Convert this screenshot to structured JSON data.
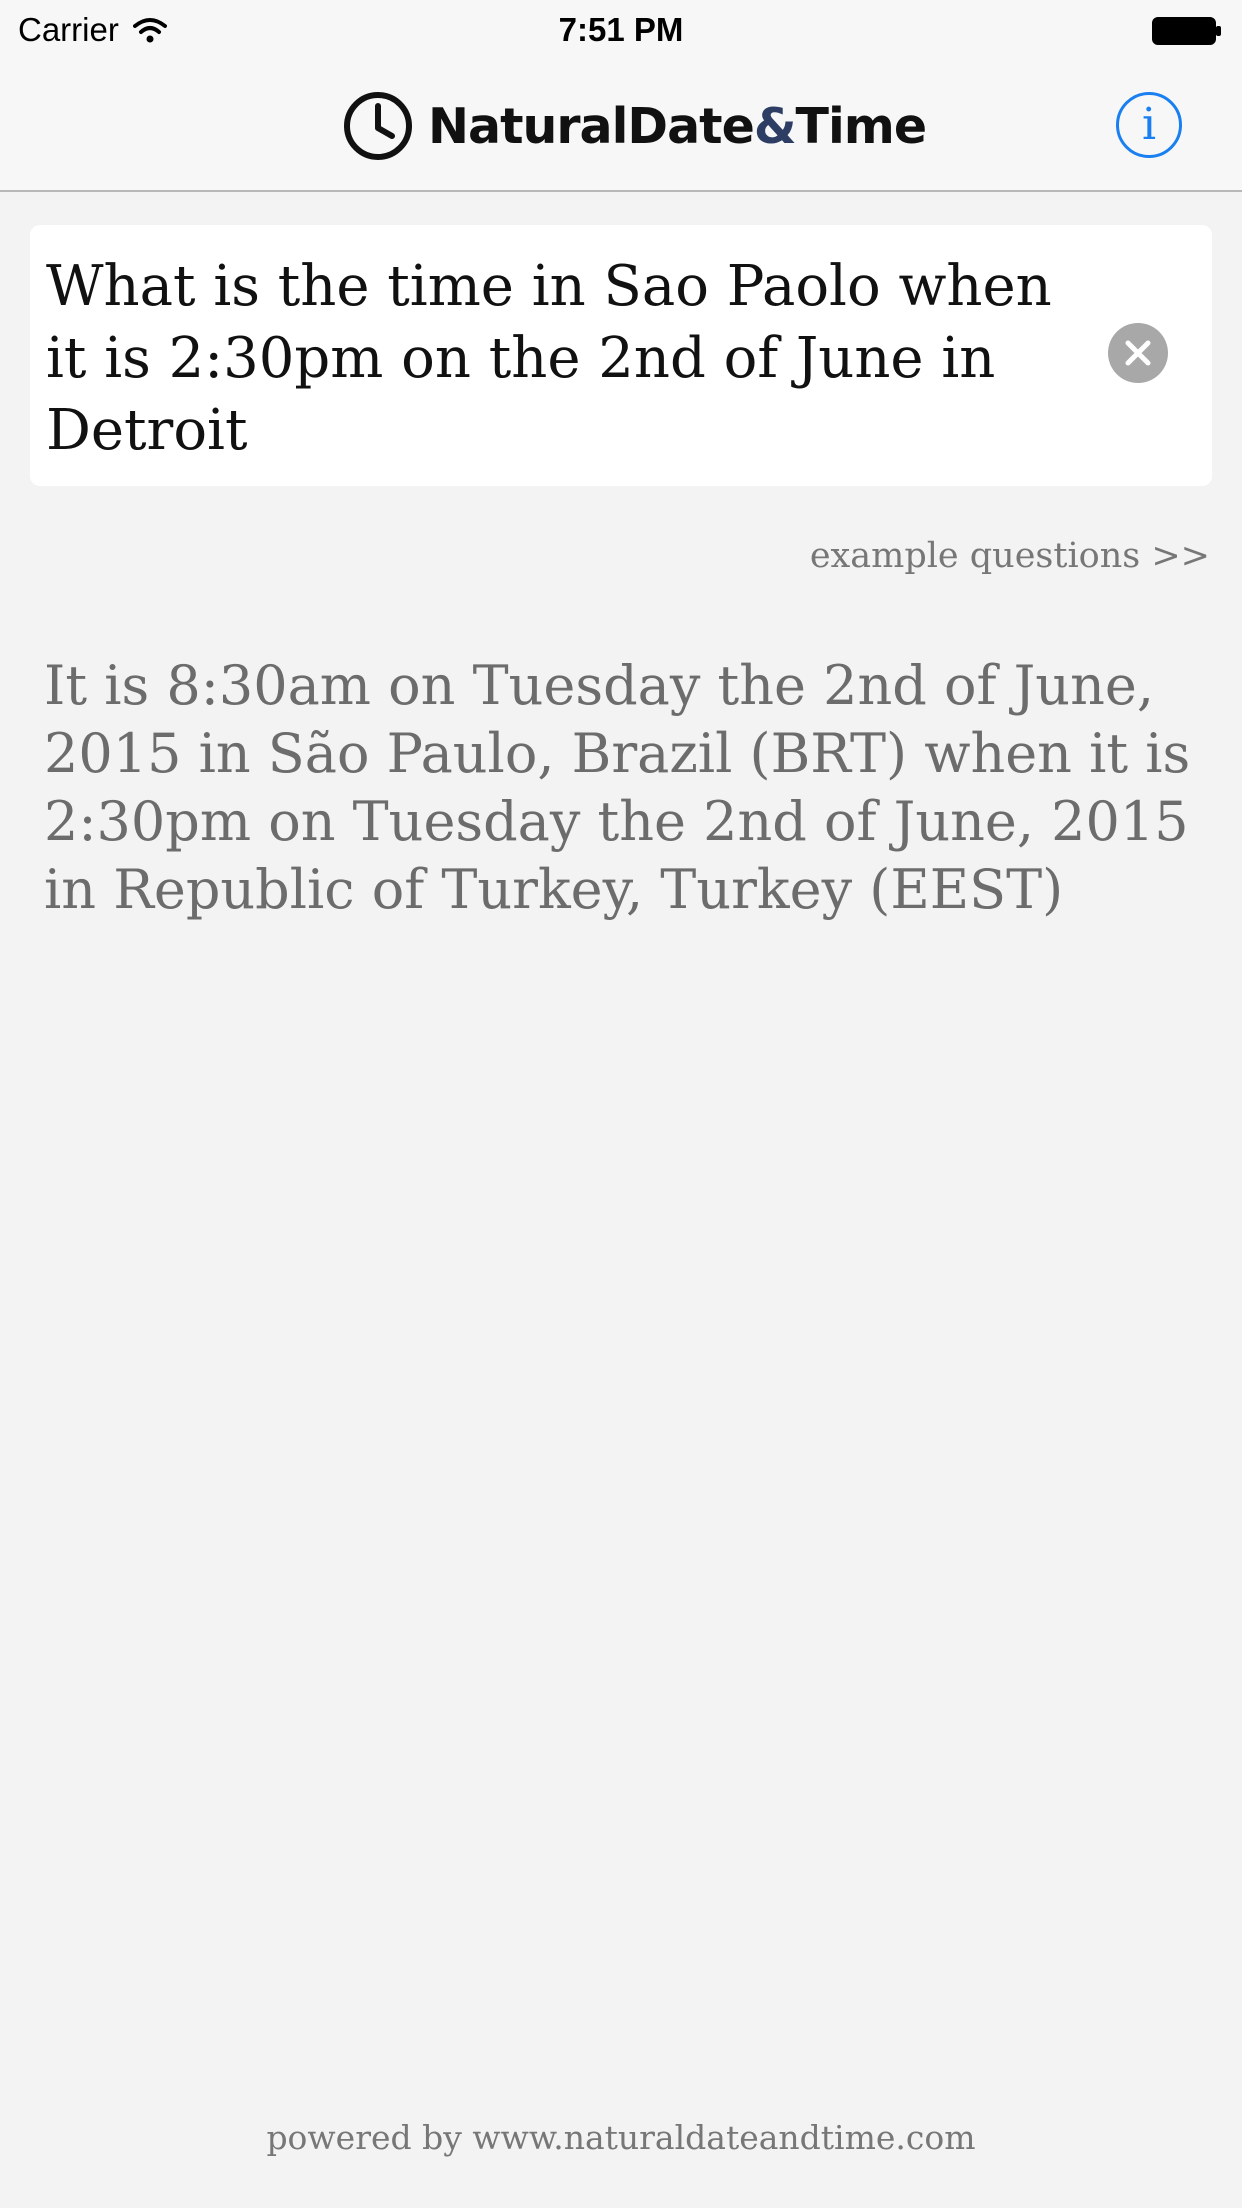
{
  "status_bar": {
    "carrier": "Carrier",
    "time": "7:51 PM",
    "wifi_icon": "wifi-icon",
    "battery_icon": "battery-icon"
  },
  "nav": {
    "logo_part1": "NaturalDate",
    "logo_amp": "&",
    "logo_part2": "Time",
    "logo_icon": "clock-icon",
    "info_icon": "info-icon",
    "info_glyph": "i"
  },
  "query": {
    "value": "What is the time in Sao Paolo when it is 2:30pm on the 2nd of June in Detroit",
    "clear_icon": "close-icon"
  },
  "example_link": "example questions >>",
  "answer": "It is 8:30am on Tuesday the 2nd of June, 2015 in São Paulo, Brazil (BRT) when it is 2:30pm on Tuesday the 2nd of June, 2015 in Republic of Turkey, Turkey (EEST)",
  "footer": "powered by www.naturaldateandtime.com",
  "colors": {
    "accent": "#1a7ff0",
    "logo_amp": "#2d3d63",
    "background": "#f3f3f3",
    "answer_text": "#6c6c6c"
  }
}
